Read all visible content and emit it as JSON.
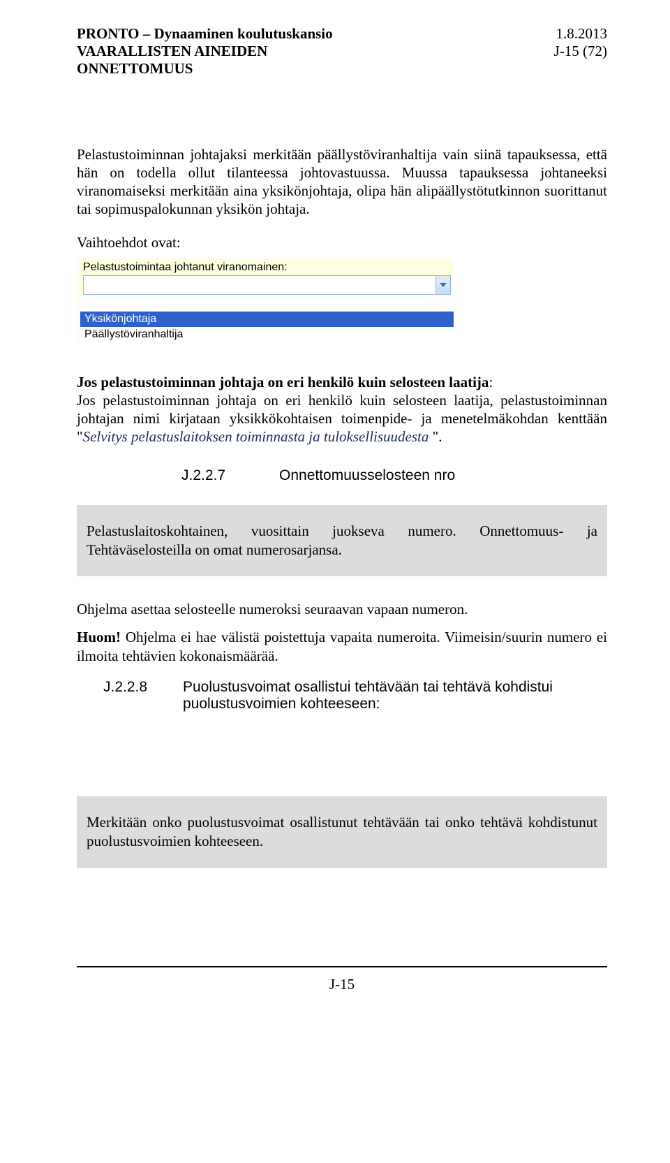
{
  "header": {
    "l1": "PRONTO – Dynaaminen koulutuskansio",
    "l2": "VAARALLISTEN AINEIDEN",
    "l3": "ONNETTOMUUS",
    "r1": "1.8.2013",
    "r2": "J-15 (72)"
  },
  "p1": "Pelastustoiminnan johtajaksi merkitään päällystöviranhaltija vain siinä tapauksessa, että hän on todella ollut tilanteessa johtovastuussa. Muussa tapauksessa johtaneeksi viranomaiseksi merkitään aina yksikönjohtaja, olipa hän alipäällystötutkinnon suorittanut tai sopimuspalokunnan yksikön johtaja.",
  "p2": "Vaihtoehdot ovat:",
  "dropdown": {
    "caption": "Pelastustoimintaa johtanut viranomainen:",
    "opt_selected": "Yksikönjohtaja",
    "opt2": "Päällystöviranhaltija"
  },
  "p3_bold": "Jos pelastustoiminnan johtaja on eri henkilö kuin selosteen laatija",
  "p3_after_bold": ":",
  "p3_rest": "Jos pelastustoiminnan johtaja on eri henkilö kuin selosteen laatija, pelastustoiminnan johtajan nimi kirjataan yksikkökohtaisen toimenpide- ja menetelmäkohdan kenttään \"",
  "p3_italic": "Selvitys pelastuslaitoksen toiminnasta ja tuloksellisuudesta",
  "p3_end": " \".",
  "sec1": {
    "num": "J.2.2.7",
    "title": "Onnettomuusselosteen nro"
  },
  "gray1": "Pelastuslaitoskohtainen, vuosittain juokseva numero. Onnettomuus- ja Tehtäväselosteilla on omat numerosarjansa.",
  "p4": "Ohjelma asettaa selosteelle numeroksi seuraavan vapaan numeron.",
  "p5_lead": "Huom!",
  "p5_rest": " Ohjelma ei hae välistä poistettuja vapaita numeroita. Viimeisin/suurin numero ei ilmoita tehtävien kokonaismäärää.",
  "sec2": {
    "num": "J.2.2.8",
    "title": "Puolustusvoimat osallistui tehtävään tai tehtävä kohdistui puolustusvoimien kohteeseen:"
  },
  "gray2": "Merkitään onko puolustusvoimat osallistunut tehtävään tai onko tehtävä kohdistunut puolustusvoimien kohteeseen.",
  "footer": "J-15"
}
